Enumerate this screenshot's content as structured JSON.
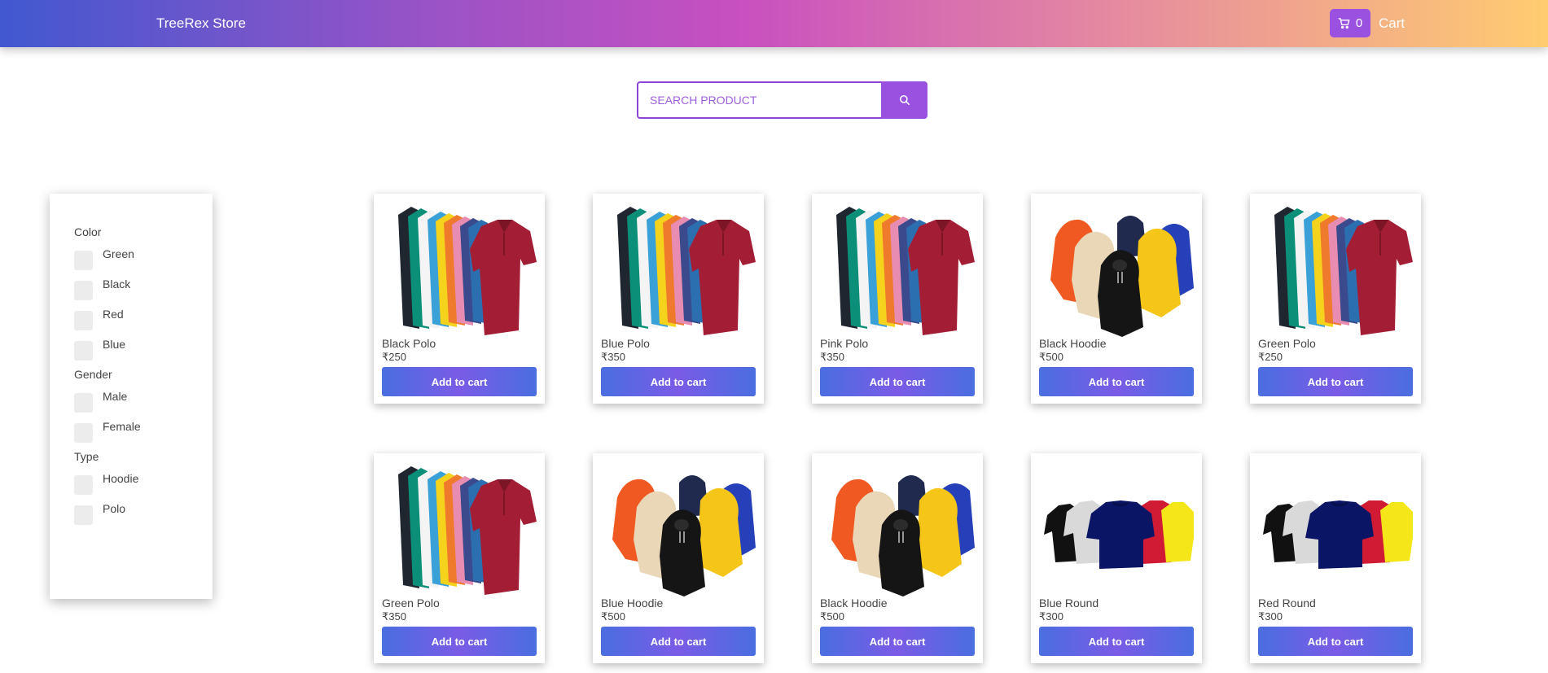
{
  "navbar": {
    "brand": "TreeRex Store",
    "cart_count": "0",
    "cart_label": "Cart"
  },
  "search": {
    "placeholder": "SEARCH PRODUCT",
    "button_icon": "search-icon"
  },
  "filters": {
    "color": {
      "heading": "Color",
      "options": [
        "Green",
        "Black",
        "Red",
        "Blue"
      ]
    },
    "gender": {
      "heading": "Gender",
      "options": [
        "Male",
        "Female"
      ]
    },
    "type": {
      "heading": "Type",
      "options": [
        "Hoodie",
        "Polo"
      ]
    }
  },
  "products": [
    {
      "name": "Black Polo",
      "price": "₹250",
      "image": "polo-shirts-image",
      "button": "Add to cart"
    },
    {
      "name": "Blue Polo",
      "price": "₹350",
      "image": "polo-shirts-image",
      "button": "Add to cart"
    },
    {
      "name": "Pink Polo",
      "price": "₹350",
      "image": "polo-shirts-image",
      "button": "Add to cart"
    },
    {
      "name": "Black Hoodie",
      "price": "₹500",
      "image": "hoodies-image",
      "button": "Add to cart"
    },
    {
      "name": "Green Polo",
      "price": "₹250",
      "image": "polo-shirts-image",
      "button": "Add to cart"
    },
    {
      "name": "Green Polo",
      "price": "₹350",
      "image": "polo-shirts-image",
      "button": "Add to cart"
    },
    {
      "name": "Blue Hoodie",
      "price": "₹500",
      "image": "hoodies-image",
      "button": "Add to cart"
    },
    {
      "name": "Black Hoodie",
      "price": "₹500",
      "image": "hoodies-image",
      "button": "Add to cart"
    },
    {
      "name": "Blue Round",
      "price": "₹300",
      "image": "round-tshirts-image",
      "button": "Add to cart"
    },
    {
      "name": "Red Round",
      "price": "₹300",
      "image": "round-tshirts-image",
      "button": "Add to cart"
    }
  ],
  "colors": {
    "accent": "#9b51e0",
    "button_gradient_start": "#4a6ee0",
    "button_gradient_mid": "#7a5be6"
  }
}
